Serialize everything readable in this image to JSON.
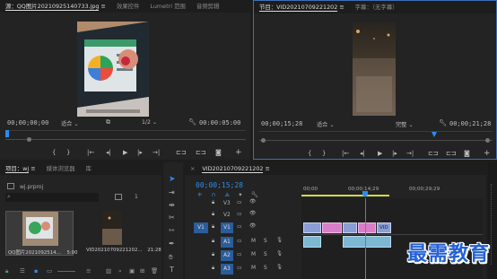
{
  "source_monitor": {
    "tabs": [
      "源：QQ图片20210925140733.jpg",
      "效果控件",
      "Lumetri 范围",
      "音频剪辑"
    ],
    "timecode": "00;00;00;00",
    "fit": "适合",
    "fraction": "1/2",
    "duration": "00:00:05:00"
  },
  "program_monitor": {
    "tabs": [
      "节目：VID20210709221202",
      "字幕：（无字幕）"
    ],
    "timecode": "00;00;15;28",
    "fit": "适合",
    "quality": "完整",
    "duration": "00;00;21;28"
  },
  "project": {
    "tabs": [
      "项目：wj",
      "媒体浏览器",
      "库"
    ],
    "filename": "wj.prproj",
    "items": [
      {
        "name": "QQ图片2021092514...",
        "duration": "5:00"
      },
      {
        "name": "VID20210709221202...",
        "duration": "21:28"
      }
    ]
  },
  "timeline": {
    "tab": "VID20210709221202",
    "timecode": "00;00;15;28",
    "ruler": [
      "00;00",
      "00;00;14;29",
      "00;00;29;29"
    ],
    "video_tracks": [
      "V3",
      "V2",
      "V1"
    ],
    "audio_tracks": [
      "A1",
      "A2",
      "A3"
    ],
    "source_patch": "V1",
    "track_toggles": [
      "M",
      "S"
    ],
    "clip_label": "VID"
  },
  "watermark": "最需教育",
  "colors": {
    "accent": "#2d8ceb",
    "clip_video": "#8a9ed6",
    "clip_pink": "#d97ec9",
    "clip_audio": "#7db7d1",
    "playhead": "#2d8ceb"
  }
}
